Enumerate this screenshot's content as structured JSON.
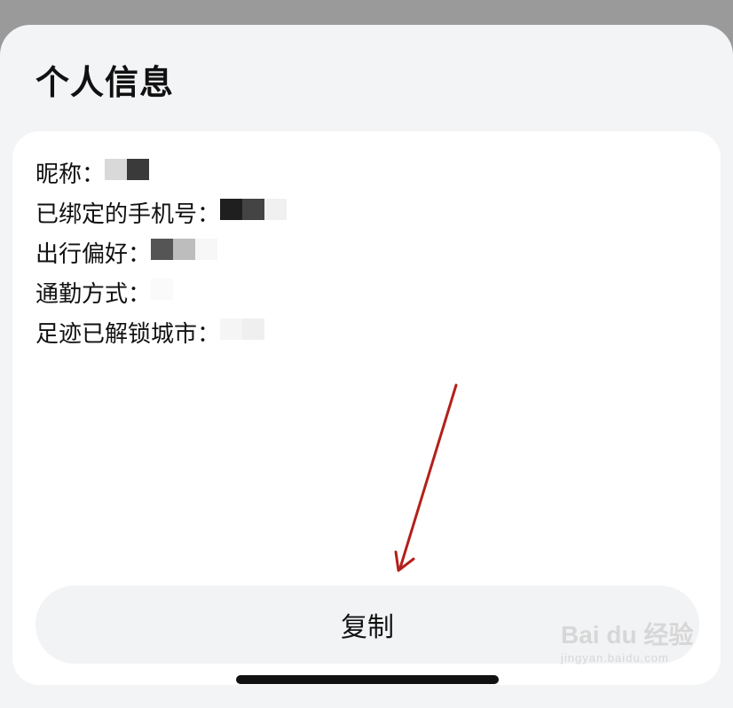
{
  "panel": {
    "title": "个人信息"
  },
  "info_rows": [
    {
      "label": "昵称：",
      "value": "",
      "mask_colors": [
        "#d9d9d9",
        "#3a3a3a"
      ]
    },
    {
      "label": "已绑定的手机号：",
      "value": "",
      "mask_colors": [
        "#1f1f1f",
        "#444444",
        "#f0f0f0"
      ]
    },
    {
      "label": "出行偏好：",
      "value": "",
      "mask_colors": [
        "#555555",
        "#bdbdbd",
        "#f7f7f7"
      ]
    },
    {
      "label": "通勤方式：",
      "value": "",
      "mask_colors": [
        "#fafafa"
      ]
    },
    {
      "label": "足迹已解锁城市：",
      "value": "",
      "mask_colors": [
        "#f5f5f5",
        "#efefef"
      ]
    }
  ],
  "actions": {
    "copy_label": "复制"
  },
  "annotation": {
    "arrow_color": "#b3201a"
  },
  "watermark": {
    "main": "Bai du 经验",
    "sub": "jingyan.baidu.com"
  },
  "colors": {
    "overlay": "#9a9a9a",
    "sheet": "#f3f4f6",
    "card": "#ffffff",
    "button": "#f2f3f5"
  }
}
